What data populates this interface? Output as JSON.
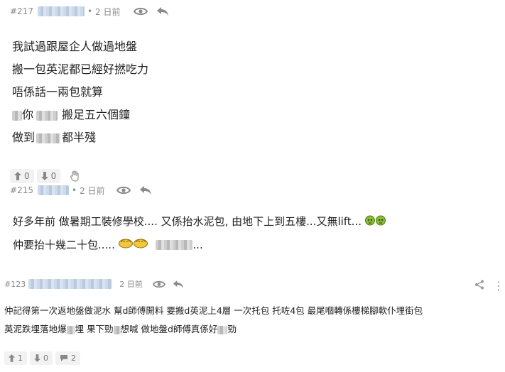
{
  "posts": [
    {
      "number": "#217",
      "time": "2 日前",
      "lines": [
        [
          "我試過跟屋企人做過地盤"
        ],
        [
          "搬一包英泥都已經好撚吃力"
        ],
        [
          "唔係話一兩包就算"
        ],
        [
          "你",
          "搬足五六個鐘"
        ],
        [
          "做到",
          "都半殘"
        ]
      ],
      "upvotes": "0",
      "downvotes": "0"
    },
    {
      "number": "#215",
      "time": "2 日前",
      "line1": "好多年前 做暑期工裝修學校.... 又係抬水泥包, 由地下上到五樓...又無lift...",
      "line2": "仲要抬十幾二十包.....",
      "line2_tail": "..."
    },
    {
      "number": "#123",
      "time": "2 日前",
      "line1": "仲記得第一次返地盤做泥水 幫d師傅開料 要搬d英泥上4層 一次托包 托咗4包 最尾嗰轉係樓梯腳軟仆埋街包",
      "line2_a": "英泥跌埋落地爆",
      "line2_b": "埋 果下",
      "line2_c": "勁",
      "line2_d": "想喊 做地盤d師傅真係好",
      "line2_e": "勁",
      "upvotes": "1",
      "downvotes": "0",
      "replies": "2"
    }
  ],
  "icons": {
    "view": "eye-icon",
    "reply": "reply-arrow-icon",
    "upvote": "thumbs-up-icon",
    "downvote": "thumbs-down-icon",
    "report": "hand-icon",
    "share": "share-icon",
    "comments": "comment-bubble-icon"
  },
  "colors": {
    "meta_text": "#8a8a8a",
    "body_text": "#1f1f1f",
    "vote_bg": "#f2f2f2",
    "blur_blue": "#c7d6e8"
  }
}
